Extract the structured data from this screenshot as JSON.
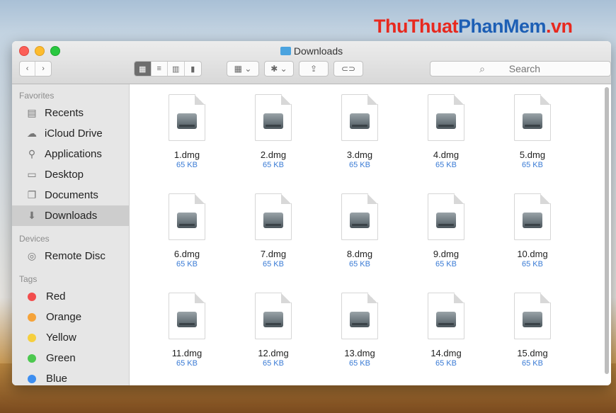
{
  "watermark": {
    "part1": "ThuThuat",
    "part2": "PhanMem",
    "part3": ".vn"
  },
  "window": {
    "title": "Downloads"
  },
  "toolbar": {
    "search_placeholder": "Search"
  },
  "sidebar": {
    "favorites_header": "Favorites",
    "favorites": [
      {
        "label": "Recents",
        "icon": "recents-icon",
        "glyph": "▤"
      },
      {
        "label": "iCloud Drive",
        "icon": "cloud-icon",
        "glyph": "☁"
      },
      {
        "label": "Applications",
        "icon": "applications-icon",
        "glyph": "⚲"
      },
      {
        "label": "Desktop",
        "icon": "desktop-icon",
        "glyph": "▭"
      },
      {
        "label": "Documents",
        "icon": "documents-icon",
        "glyph": "❐"
      },
      {
        "label": "Downloads",
        "icon": "downloads-icon",
        "glyph": "⬇"
      }
    ],
    "devices_header": "Devices",
    "devices": [
      {
        "label": "Remote Disc",
        "icon": "disc-icon",
        "glyph": "◎"
      }
    ],
    "tags_header": "Tags",
    "tags": [
      {
        "label": "Red",
        "color": "#f24d4d"
      },
      {
        "label": "Orange",
        "color": "#f5a33a"
      },
      {
        "label": "Yellow",
        "color": "#f6cf3e"
      },
      {
        "label": "Green",
        "color": "#4cc84f"
      },
      {
        "label": "Blue",
        "color": "#3d8ef0"
      }
    ]
  },
  "files": [
    {
      "name": "1.dmg",
      "size": "65 KB"
    },
    {
      "name": "2.dmg",
      "size": "65 KB"
    },
    {
      "name": "3.dmg",
      "size": "65 KB"
    },
    {
      "name": "4.dmg",
      "size": "65 KB"
    },
    {
      "name": "5.dmg",
      "size": "65 KB"
    },
    {
      "name": "6.dmg",
      "size": "65 KB"
    },
    {
      "name": "7.dmg",
      "size": "65 KB"
    },
    {
      "name": "8.dmg",
      "size": "65 KB"
    },
    {
      "name": "9.dmg",
      "size": "65 KB"
    },
    {
      "name": "10.dmg",
      "size": "65 KB"
    },
    {
      "name": "11.dmg",
      "size": "65 KB"
    },
    {
      "name": "12.dmg",
      "size": "65 KB"
    },
    {
      "name": "13.dmg",
      "size": "65 KB"
    },
    {
      "name": "14.dmg",
      "size": "65 KB"
    },
    {
      "name": "15.dmg",
      "size": "65 KB"
    }
  ]
}
